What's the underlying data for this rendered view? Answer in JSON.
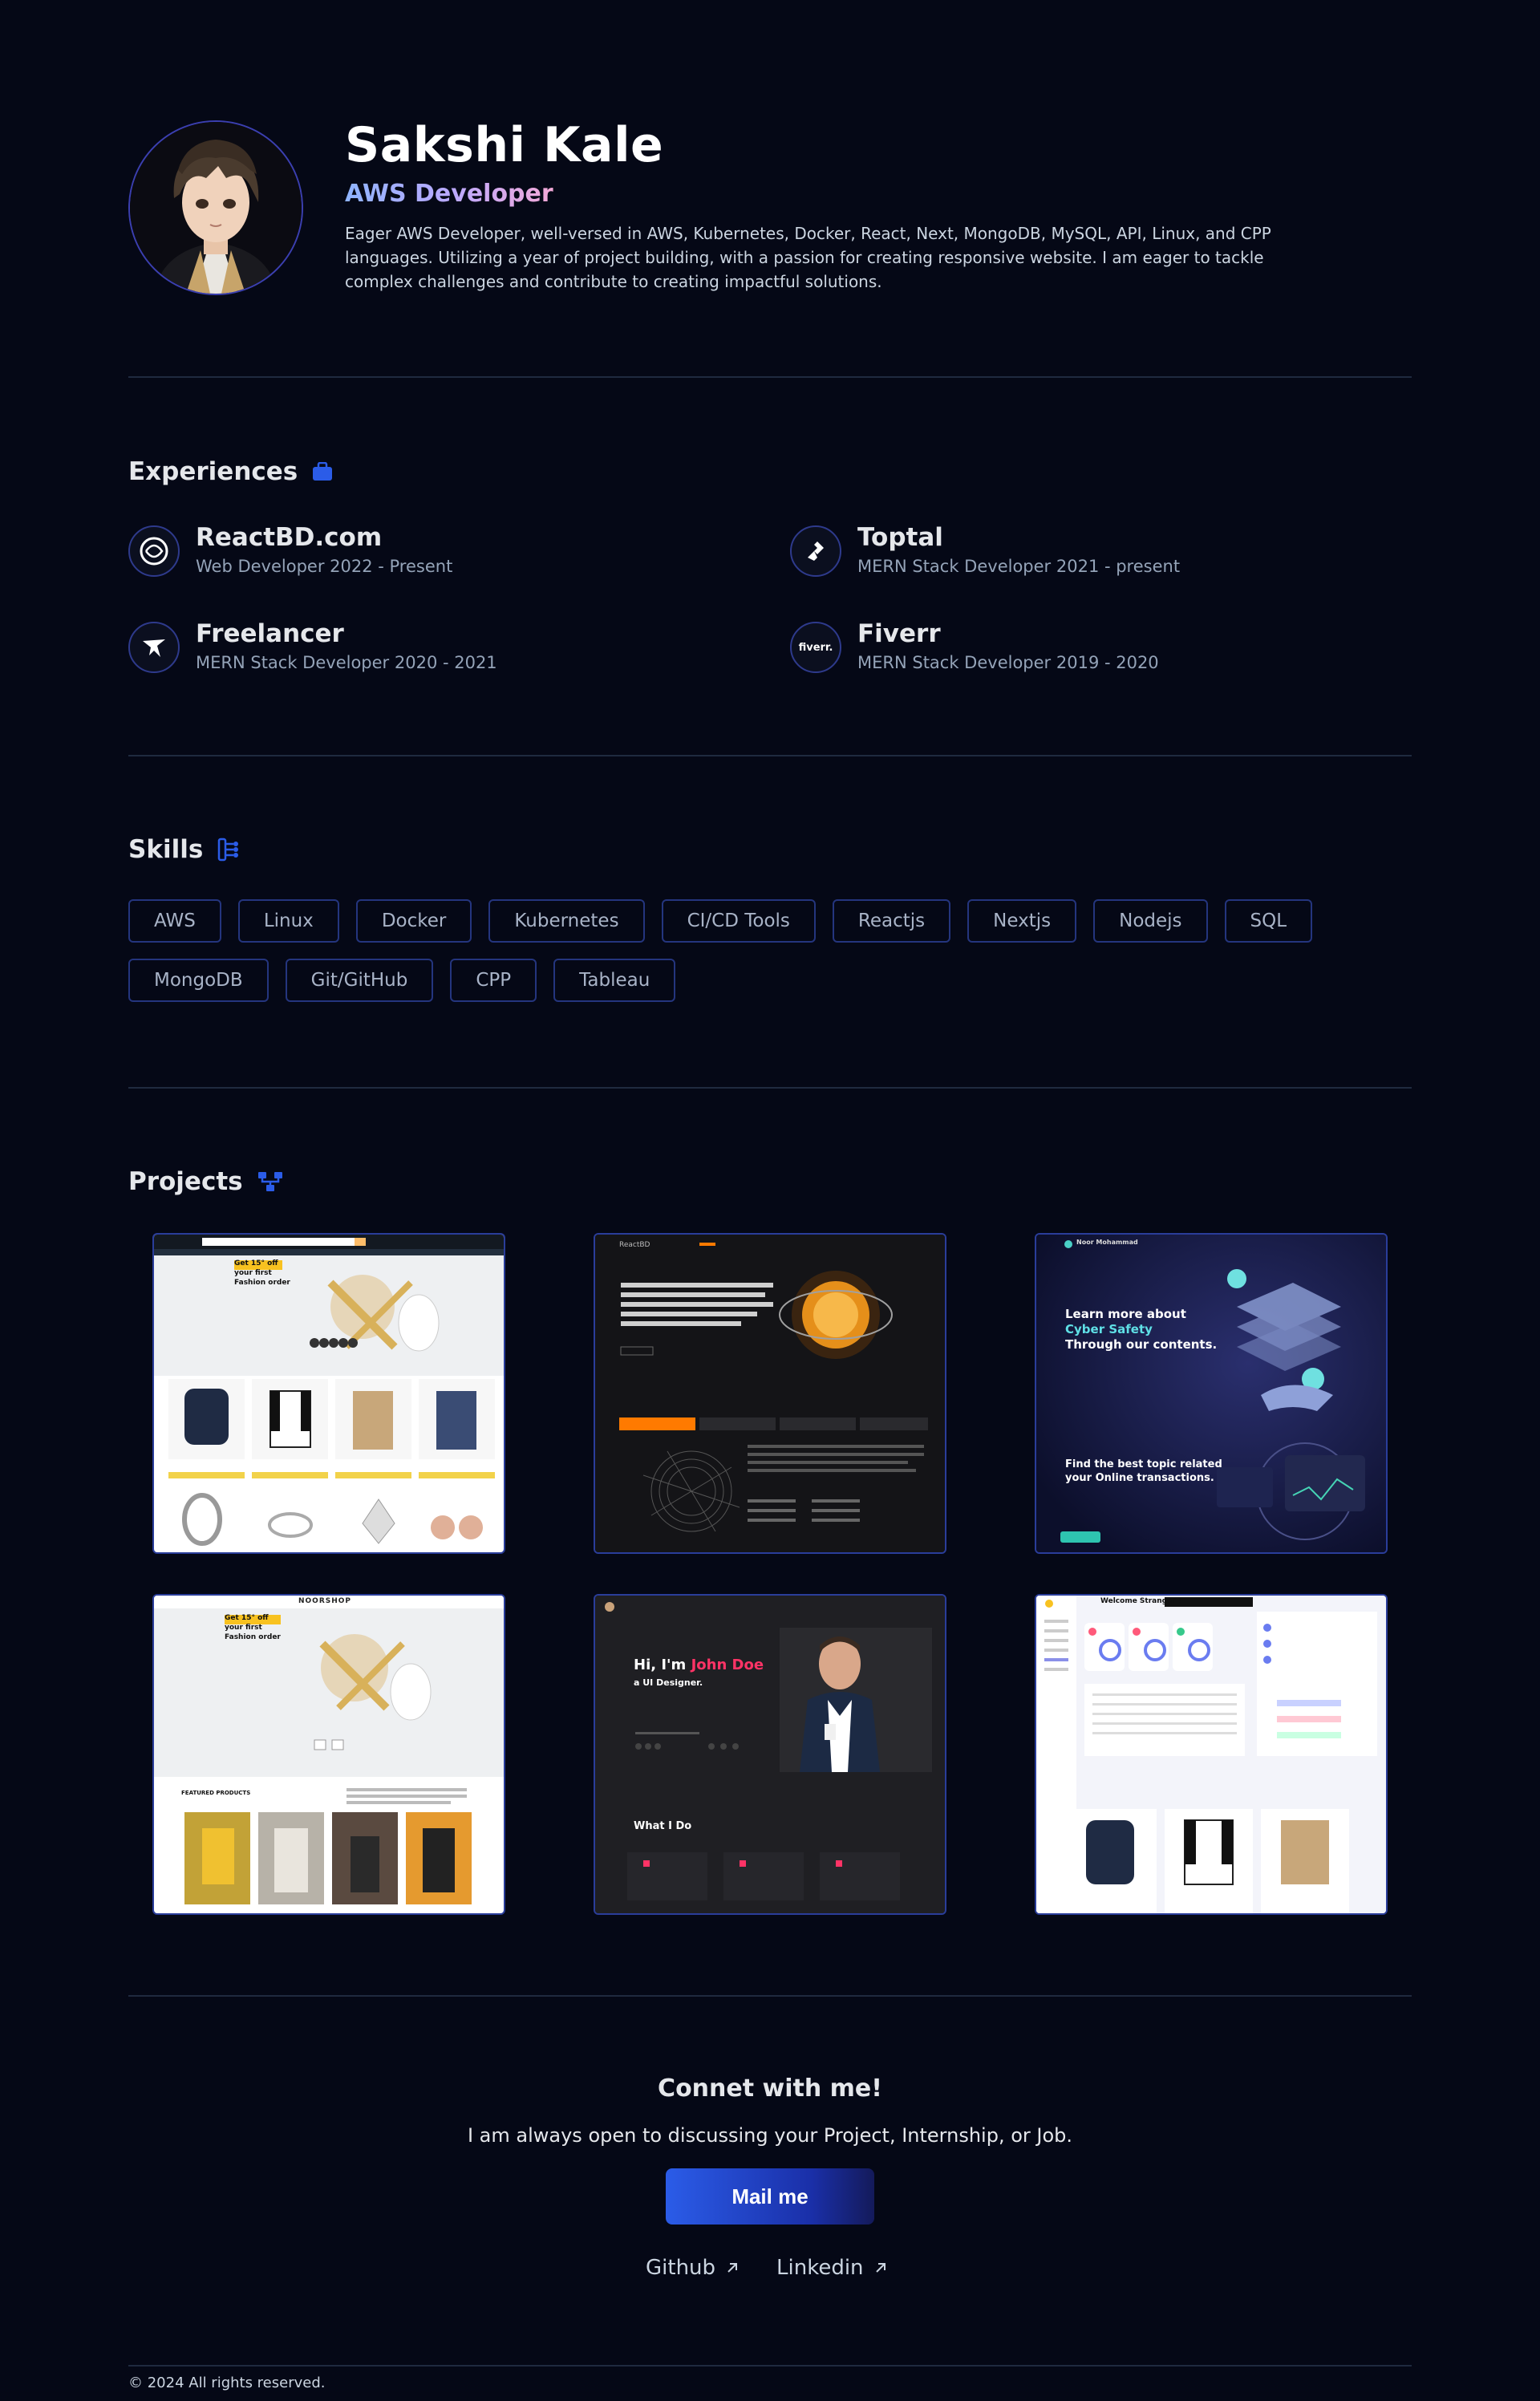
{
  "header": {
    "name": "Sakshi Kale",
    "role": "AWS Developer",
    "bio": "Eager AWS Developer, well-versed in AWS, Kubernetes, Docker, React, Next, MongoDB, MySQL, API, Linux, and CPP languages. Utilizing a year of project building, with a passion for creating responsive website. I am eager to tackle complex challenges and contribute to creating impactful solutions."
  },
  "experiences": {
    "title": "Experiences",
    "items": [
      {
        "company": "ReactBD.com",
        "role": "Web Developer 2022 - Present",
        "icon": "reactbd-logo-icon"
      },
      {
        "company": "Toptal",
        "role": "MERN Stack Developer 2021 - present",
        "icon": "toptal-logo-icon"
      },
      {
        "company": "Freelancer",
        "role": "MERN Stack Developer 2020 - 2021",
        "icon": "freelancer-logo-icon"
      },
      {
        "company": "Fiverr",
        "role": "MERN Stack Developer 2019 - 2020",
        "icon": "fiverr-logo-icon",
        "logo_text": "fiverr."
      }
    ]
  },
  "skills": {
    "title": "Skills",
    "items": [
      "AWS",
      "Linux",
      "Docker",
      "Kubernetes",
      "CI/CD Tools",
      "Reactjs",
      "Nextjs",
      "Nodejs",
      "SQL",
      "MongoDB",
      "Git/GitHub",
      "CPP",
      "Tableau"
    ]
  },
  "projects": {
    "title": "Projects",
    "previews": {
      "p1": {
        "promo_top": "Get 15° off",
        "promo_lines": [
          "your first",
          "Fashion order"
        ]
      },
      "p2": {
        "logo": "ReactBD"
      },
      "p3": {
        "logo": "Noor Mohammad",
        "headline": [
          "Learn more about",
          "Cyber Safety",
          "Through our contents."
        ],
        "subhead": [
          "Find the best topic related",
          "your Online transactions."
        ]
      },
      "p4": {
        "logo": "NOORSHOP",
        "promo_top": "Get 15° off",
        "promo_lines": [
          "your first",
          "Fashion order"
        ],
        "section": "FEATURED PRODUCTS"
      },
      "p5": {
        "greeting": "Hi, I'm",
        "name": "John Doe",
        "role": "a UI Designer.",
        "section": "What I Do"
      },
      "p6": {
        "title": "Welcome Stranger !"
      }
    }
  },
  "connect": {
    "title": "Connet with me!",
    "subtitle": "I am always open to discussing your Project, Internship, or Job.",
    "mail_label": "Mail me",
    "github_label": "Github",
    "linkedin_label": "Linkedin"
  },
  "footer": {
    "copyright": "© 2024 All rights reserved."
  },
  "colors": {
    "background": "#050816",
    "accent": "#2b5ce8",
    "border": "#24357e"
  }
}
